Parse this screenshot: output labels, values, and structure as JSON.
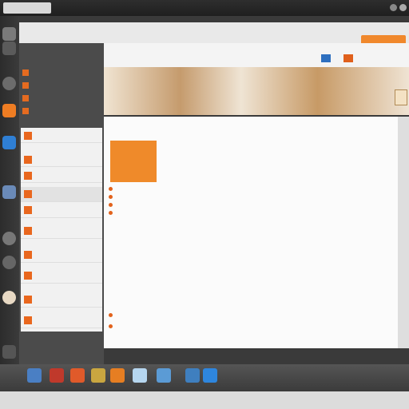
{
  "top_tabs": [
    "",
    "",
    "",
    "",
    ""
  ],
  "top_menu": [
    "",
    "",
    "",
    "",
    ""
  ],
  "subbar": {
    "items": [
      "",
      "",
      "",
      ""
    ]
  },
  "sidebar": {
    "heading": "",
    "items": [
      "",
      "",
      "",
      "",
      "",
      "",
      "",
      ""
    ]
  },
  "mainbar": {
    "items": [
      "",
      "",
      "",
      ""
    ]
  },
  "content": {
    "header": "",
    "hero_text": "",
    "bullets": [
      "",
      "",
      "",
      "",
      "",
      ""
    ],
    "paragraph_lines": [
      "",
      "",
      "",
      "",
      "",
      "",
      "",
      "",
      "",
      "",
      "",
      ""
    ]
  },
  "list_items": [
    "",
    "",
    "",
    "",
    "",
    "",
    "",
    "",
    "",
    "",
    "",
    "",
    ""
  ],
  "colors": {
    "accent": "#ef8a2a",
    "dark": "#3a3a3a",
    "sidebar": "#4b4b4b"
  }
}
